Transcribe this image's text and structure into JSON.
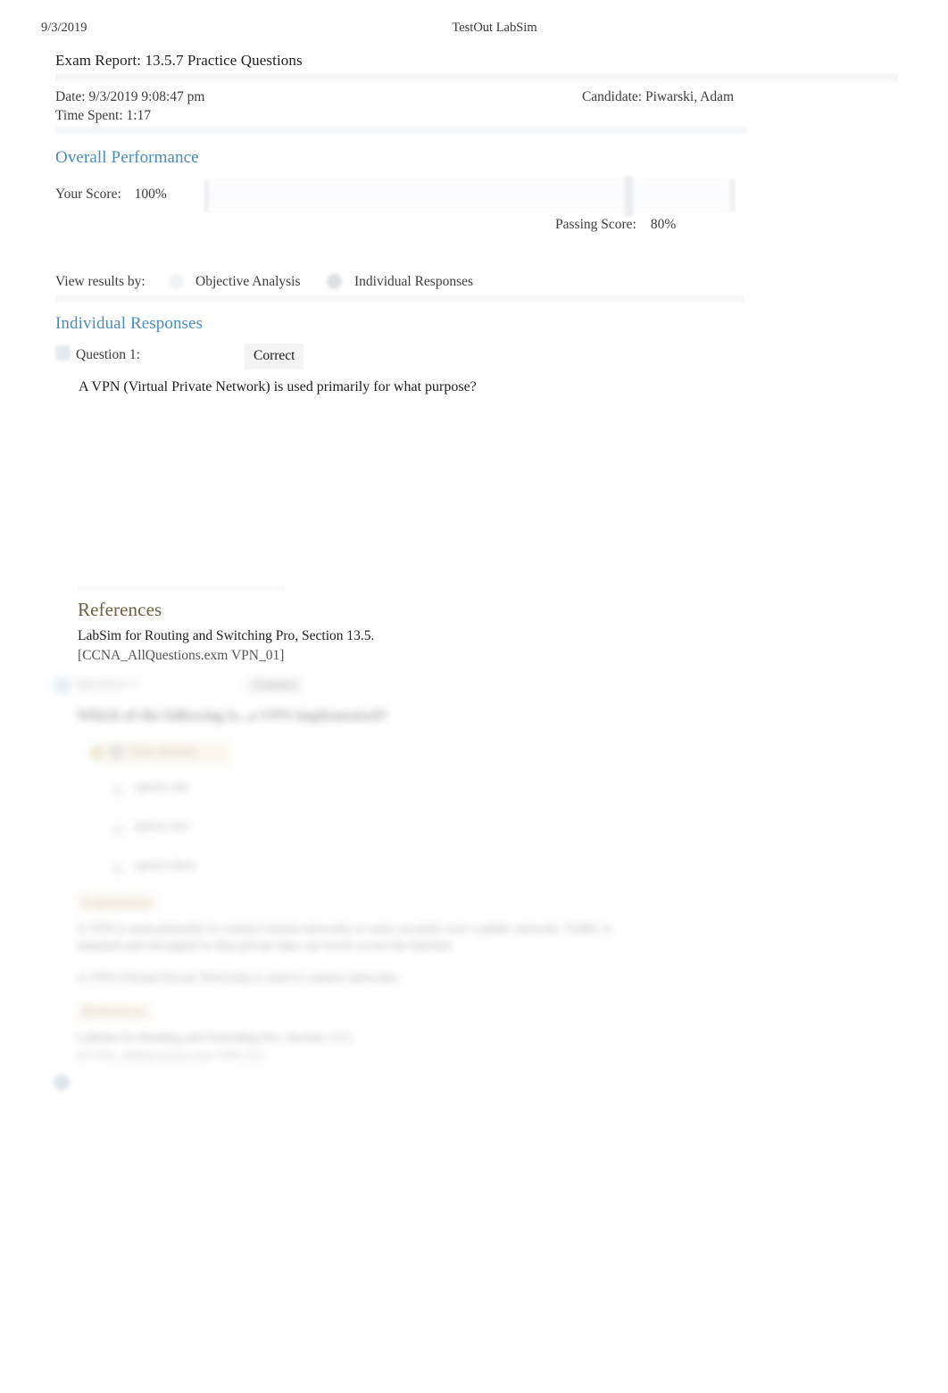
{
  "print_header": {
    "date": "9/3/2019",
    "app_title": "TestOut LabSim"
  },
  "report": {
    "title": "Exam Report: 13.5.7 Practice Questions",
    "date_label": "Date: 9/3/2019 9:08:47 pm",
    "time_spent_label": "Time Spent: 1:17",
    "candidate_label": "Candidate: Piwarski, Adam"
  },
  "overall_performance": {
    "heading": "Overall Performance",
    "your_score_label": "Your Score:",
    "your_score_value": "100%",
    "passing_score_label": "Passing Score:",
    "passing_score_value": "80%",
    "score_percent": 100,
    "passing_percent": 80
  },
  "view_results": {
    "label": "View results by:",
    "options": [
      {
        "label": "Objective Analysis",
        "selected": false
      },
      {
        "label": "Individual Responses",
        "selected": true
      }
    ]
  },
  "individual_responses": {
    "heading": "Individual Responses",
    "questions": [
      {
        "number_label": "Question 1:",
        "result": "Correct",
        "text": "A VPN (Virtual Private Network) is used primarily for what purpose?",
        "references": {
          "heading": "References",
          "line1": "LabSim for Routing and Switching Pro, Section 13.5.",
          "line2": "[CCNA_AllQuestions.exm VPN_01]"
        }
      }
    ]
  },
  "ghost_section": {
    "question_number_label": "Question 1:",
    "result": "Correct",
    "question_text": "Which of the following is...a VPN implemented?",
    "your_answer_label": "Your Answer",
    "options": [
      "option one",
      "option two",
      "option three"
    ],
    "explanation_heading": "Explanation",
    "explanation_body": "A VPN is used primarily to connect remote networks or users securely over a public network. Traffic is tunneled and encrypted so that private data can travel across the Internet.",
    "explanation_extra": "A VPN (Virtual Private Network) is used to connect networks.",
    "references_heading": "References",
    "references_line1": "LabSim for Routing and Switching Pro, Section 13.5.",
    "references_line2": "[CCNA_AllQuestions.exm VPN_01]"
  },
  "colors": {
    "heading_blue": "#4a8cc0",
    "references_brown": "#6e6040",
    "body_text": "#2b2b2b",
    "page_background": "#ffffff"
  }
}
